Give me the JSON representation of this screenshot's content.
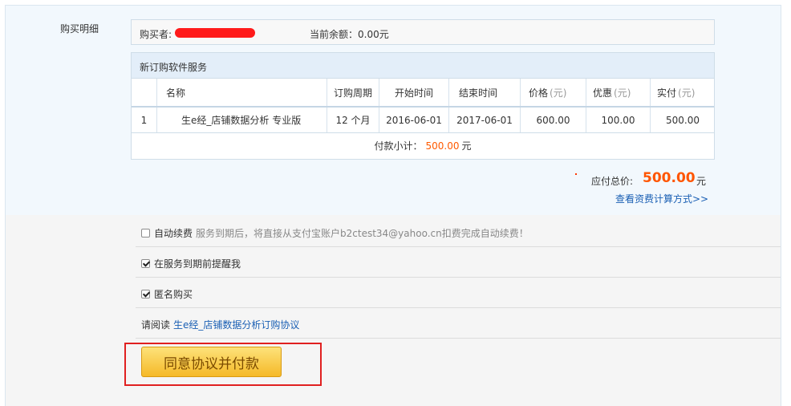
{
  "section_label": "购买明细",
  "buyer": {
    "label": "购买者:",
    "balance": "当前余额：0.00元"
  },
  "order": {
    "title": "新订购软件服务",
    "headers": [
      "",
      "名称",
      "订购周期",
      "开始时间",
      "结束时间",
      "价格",
      "优惠",
      "实付"
    ],
    "unit": "(元)",
    "rows": [
      [
        "1",
        "生e经_店铺数据分析 专业版",
        "12 个月",
        "2016-06-01",
        "2017-06-01",
        "600.00",
        "100.00",
        "500.00"
      ]
    ],
    "subtotal_label": "付款小计：",
    "subtotal_value": "500.00",
    "subtotal_unit": "元"
  },
  "total": {
    "label": "应付总价:",
    "amount": "500.00",
    "unit": "元",
    "link": "查看资费计算方式>>"
  },
  "options": {
    "auto_renew": {
      "label": "自动续费",
      "hint": "服务到期后，将直接从支付宝账户b2ctest34@yahoo.cn扣费完成自动续费！",
      "checked": false
    },
    "remind": {
      "label": "在服务到期前提醒我",
      "checked": true
    },
    "anonymous": {
      "label": "匿名购买",
      "checked": true
    },
    "agreement": {
      "prefix": "请阅读",
      "link": "生e经_店铺数据分析订购协议"
    }
  },
  "pay_button": "同意协议并付款",
  "colors": {
    "accent_orange": "#ff5500",
    "link_blue": "#1a5fb4",
    "highlight_red": "#e02020"
  }
}
